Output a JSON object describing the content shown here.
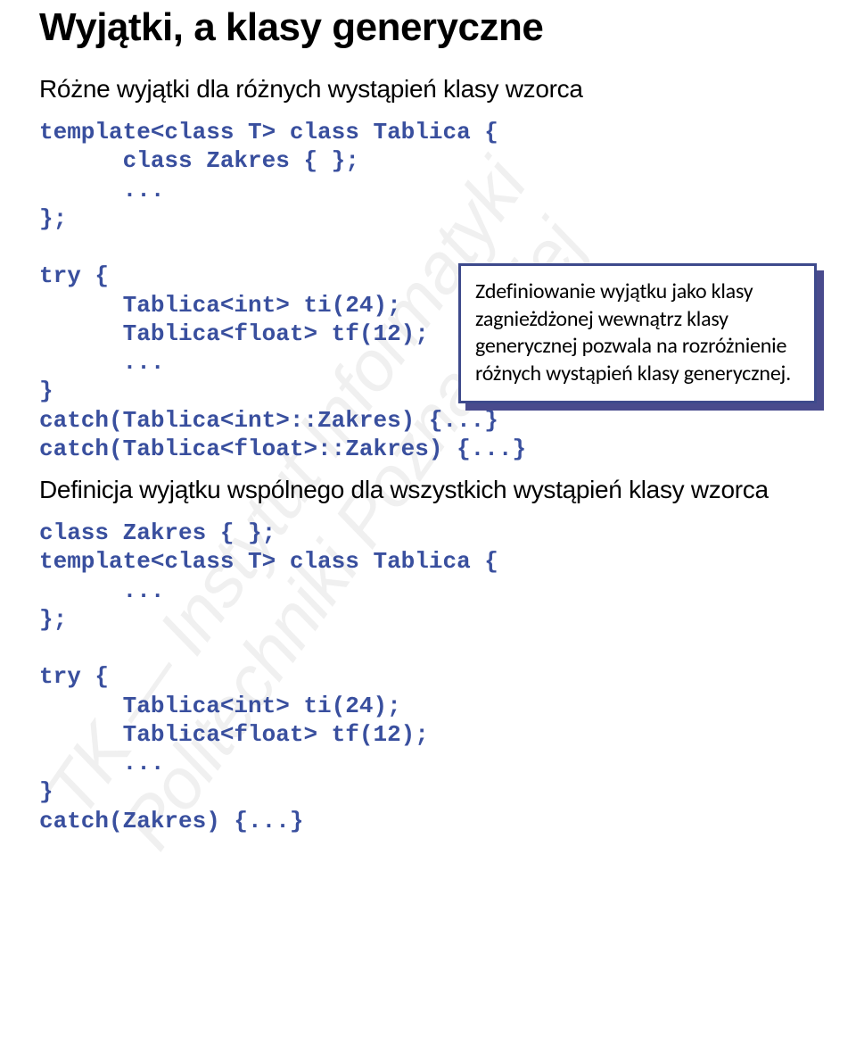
{
  "title": "Wyjątki, a klasy generyczne",
  "para1": "Różne wyjątki dla różnych wystąpień klasy wzorca",
  "code1": "template<class T> class Tablica {\n      class Zakres { };\n      ...\n};\n\ntry {\n      Tablica<int> ti(24);\n      Tablica<float> tf(12);\n      ...\n}\ncatch(Tablica<int>::Zakres) {...}\ncatch(Tablica<float>::Zakres) {...}",
  "calloutText": "Zdefiniowanie wyjątku jako klasy zagnieżdżonej wewnątrz klasy generycznej pozwala na rozróżnienie różnych wystąpień klasy generycznej.",
  "para2": "Definicja wyjątku wspólnego dla wszystkich wystąpień klasy wzorca",
  "code2": "class Zakres { };\ntemplate<class T> class Tablica {\n      ...\n};\n\ntry {\n      Tablica<int> ti(24);\n      Tablica<float> tf(12);\n      ...\n}\ncatch(Zakres) {...}",
  "watermark": "TK — Instytut Informatyki Politechniki Poznańskiej"
}
